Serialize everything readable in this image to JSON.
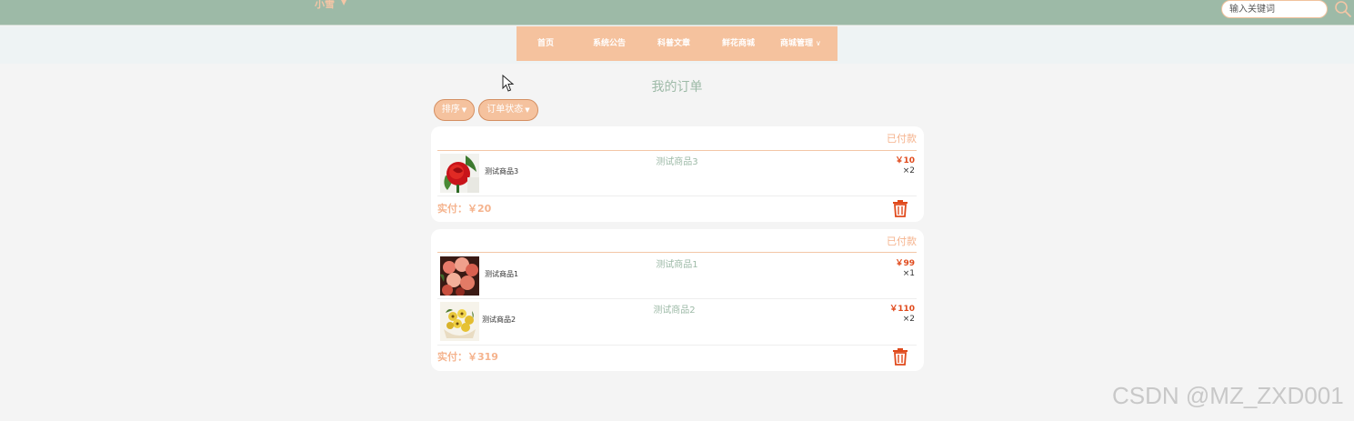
{
  "header": {
    "user": "小雪",
    "search_placeholder": "输入关键词"
  },
  "nav": {
    "items": [
      {
        "label": "首页"
      },
      {
        "label": "系统公告"
      },
      {
        "label": "科普文章"
      },
      {
        "label": "鲜花商城"
      },
      {
        "label": "商城管理",
        "has_dropdown": true
      }
    ]
  },
  "page": {
    "title": "我的订单",
    "filters": [
      {
        "label": "排序"
      },
      {
        "label": "订单状态"
      }
    ]
  },
  "orders": [
    {
      "status": "已付款",
      "items": [
        {
          "name_small": "测试商品3",
          "name": "测试商品3",
          "price": "￥10",
          "qty": "×2",
          "thumb": "red-rose"
        }
      ],
      "paid": "实付：￥20"
    },
    {
      "status": "已付款",
      "items": [
        {
          "name_small": "测试商品1",
          "name": "测试商品1",
          "price": "￥99",
          "qty": "×1",
          "thumb": "pink-bouquet"
        },
        {
          "name_small": "测试商品2",
          "name": "测试商品2",
          "price": "￥110",
          "qty": "×2",
          "thumb": "yellow-bouquet"
        }
      ],
      "paid": "实付：￥319"
    }
  ],
  "watermark": "CSDN @MZ_ZXD001",
  "colors": {
    "topbar": "#9dbaa7",
    "accent": "#f5c29e",
    "price": "#e04a1c",
    "status": "#f5b38d"
  }
}
